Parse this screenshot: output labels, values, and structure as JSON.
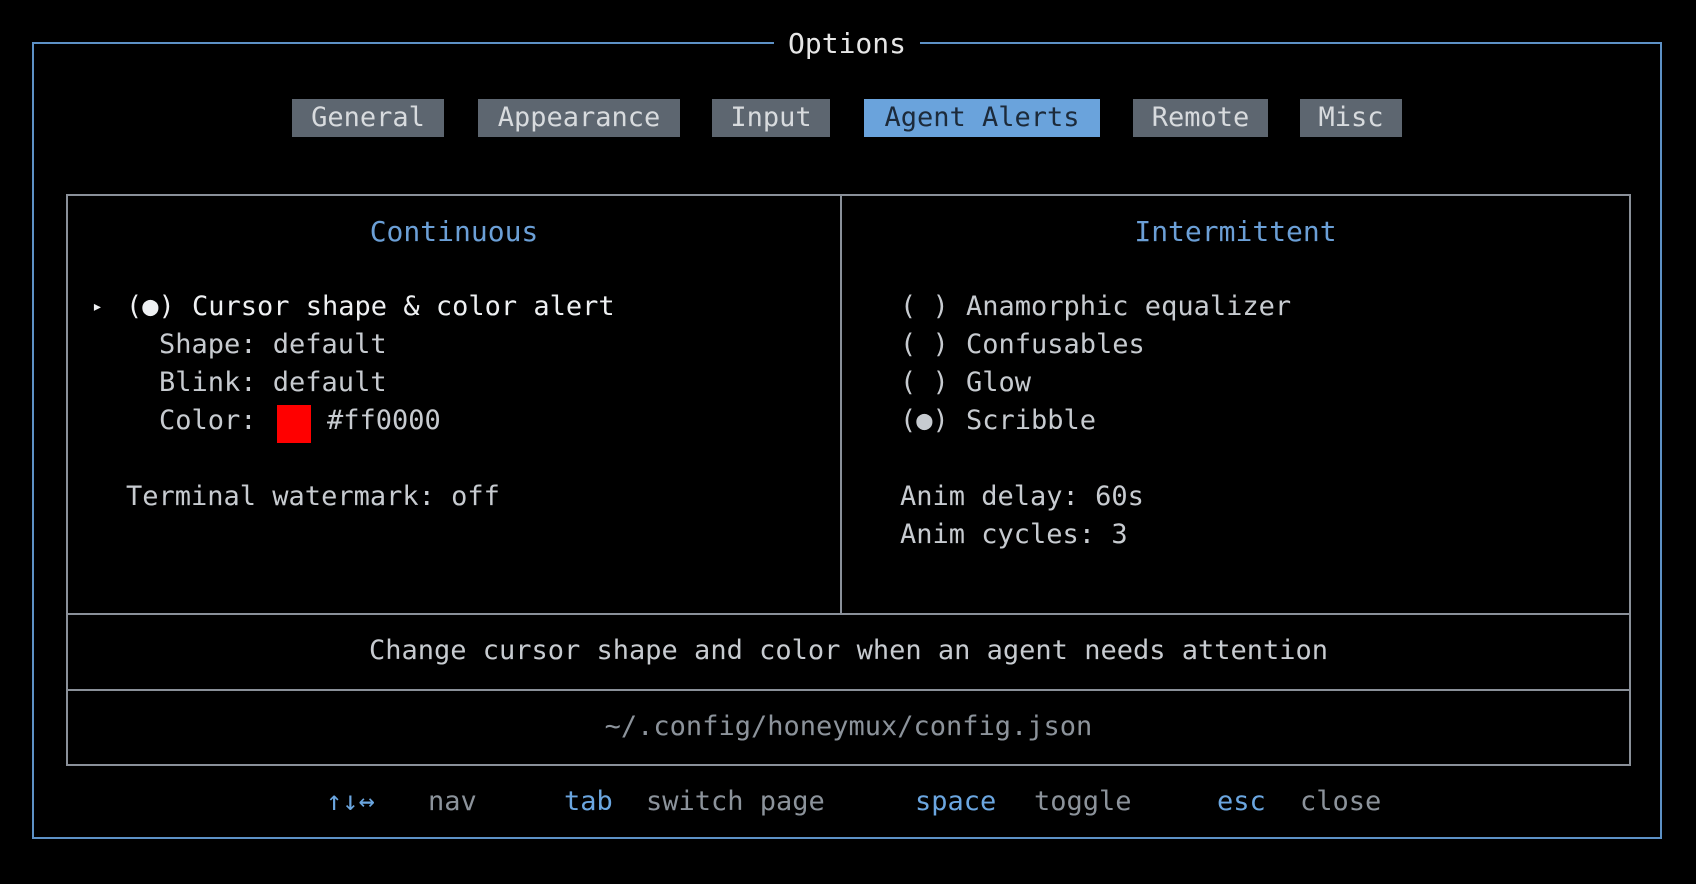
{
  "window": {
    "title": "Options"
  },
  "tabs": [
    {
      "label": "General",
      "active": false
    },
    {
      "label": "Appearance",
      "active": false
    },
    {
      "label": "Input",
      "active": false
    },
    {
      "label": "Agent Alerts",
      "active": true
    },
    {
      "label": "Remote",
      "active": false
    },
    {
      "label": "Misc",
      "active": false
    }
  ],
  "continuous": {
    "title": "Continuous",
    "cursor_marker": "▸",
    "cursor_option": {
      "radio": "(●)",
      "label": "Cursor shape & color alert",
      "selected": true
    },
    "shape": "Shape: default",
    "blink": "Blink: default",
    "color_label": "Color:",
    "color_value": "#ff0000",
    "watermark": "Terminal watermark: off"
  },
  "intermittent": {
    "title": "Intermittent",
    "options": [
      {
        "radio": "( )",
        "label": "Anamorphic equalizer",
        "selected": false
      },
      {
        "radio": "( )",
        "label": "Confusables",
        "selected": false
      },
      {
        "radio": "( )",
        "label": "Glow",
        "selected": false
      },
      {
        "radio": "(●)",
        "label": "Scribble",
        "selected": true
      }
    ],
    "anim_delay": "Anim delay: 60s",
    "anim_cycles": "Anim cycles: 3"
  },
  "description": "Change cursor shape and color when an agent needs attention",
  "config_path": "~/.config/honeymux/config.json",
  "footer": [
    {
      "key": "↑↓↔",
      "action": "nav"
    },
    {
      "key": "tab",
      "action": "switch page"
    },
    {
      "key": "space",
      "action": "toggle"
    },
    {
      "key": "esc",
      "action": "close"
    }
  ],
  "colors": {
    "border": "#5d91c6",
    "accent": "#6aa3dc",
    "tab_inactive": "#5d6670",
    "swatch": "#ff0000"
  }
}
